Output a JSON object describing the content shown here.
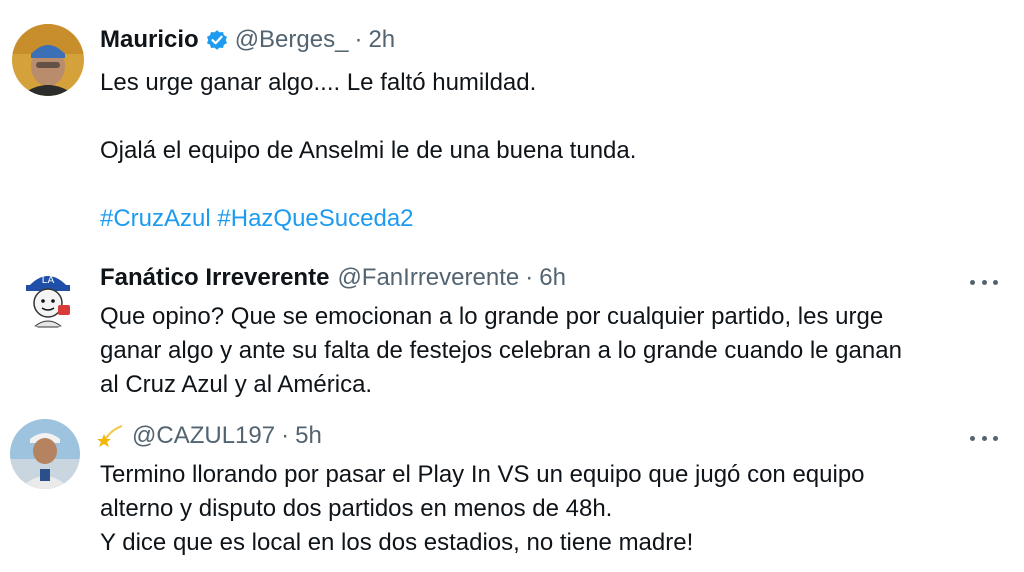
{
  "tweets": [
    {
      "name": "Mauricio",
      "handle": "@Berges_",
      "dot": "·",
      "time": "2h",
      "lines": [
        "Les urge ganar algo.... Le faltó humildad.",
        "",
        "Ojalá el equipo de Anselmi le de una buena tunda."
      ],
      "hashtags": [
        "#CruzAzul",
        "#HazQueSuceda2"
      ]
    },
    {
      "name": "Fanático Irreverente",
      "handle": "@FanIrreverente",
      "dot": "·",
      "time": "6h",
      "lines": [
        "Que opino? Que se emocionan a lo grande por cualquier partido, les urge",
        "ganar algo y ante su falta de festejos celebran a lo grande cuando le ganan",
        "al Cruz Azul y al América."
      ]
    },
    {
      "name": "",
      "handle": "@CAZUL197",
      "dot": "·",
      "time": "5h",
      "lines": [
        "Termino llorando por pasar el Play In VS un equipo que jugó con equipo",
        "alterno y disputo dos partidos en menos de 48h.",
        "Y dice que es local en los dos estadios, no tiene madre!"
      ]
    }
  ],
  "colors": {
    "text": "#0f1419",
    "secondary": "#536471",
    "link": "#1d9bf0",
    "verified": "#1d9bf0"
  }
}
